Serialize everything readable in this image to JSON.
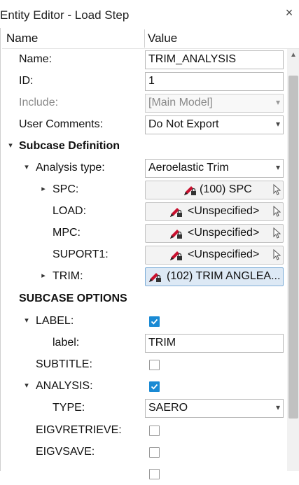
{
  "window": {
    "title": "Entity Editor - Load Step",
    "close_glyph": "×"
  },
  "columns": {
    "name": "Name",
    "value": "Value"
  },
  "fields": {
    "name": {
      "label": "Name:",
      "value": "TRIM_ANALYSIS"
    },
    "id": {
      "label": "ID:",
      "value": "1"
    },
    "include": {
      "label": "Include:",
      "value": "[Main Model]"
    },
    "user_comments": {
      "label": "User Comments:",
      "value": "Do Not Export"
    }
  },
  "subcase_definition": {
    "header": "Subcase Definition",
    "analysis_type": {
      "label": "Analysis type:",
      "value": "Aeroelastic Trim"
    },
    "spc": {
      "label": "SPC:",
      "value": "(100) SPC"
    },
    "load": {
      "label": "LOAD:",
      "value": "<Unspecified>"
    },
    "mpc": {
      "label": "MPC:",
      "value": "<Unspecified>"
    },
    "suport1": {
      "label": "SUPORT1:",
      "value": "<Unspecified>"
    },
    "trim": {
      "label": "TRIM:",
      "value": "(102) TRIM ANGLEA..."
    }
  },
  "subcase_options": {
    "header": "SUBCASE OPTIONS",
    "label_opt": {
      "label": "LABEL:",
      "checked": true
    },
    "label_value": {
      "label": "label:",
      "value": "TRIM"
    },
    "subtitle": {
      "label": "SUBTITLE:",
      "checked": false
    },
    "analysis": {
      "label": "ANALYSIS:",
      "checked": true
    },
    "type": {
      "label": "TYPE:",
      "value": "SAERO"
    },
    "eigvretrieve": {
      "label": "EIGVRETRIEVE:",
      "checked": false
    },
    "eigvsave": {
      "label": "EIGVSAVE:",
      "checked": false
    }
  },
  "icons": {
    "expand": "▾",
    "collapse": "▸",
    "dropdown": "chevron-down-icon",
    "entity": "pencil-lock-icon",
    "pointer": "pointer-icon"
  },
  "colors": {
    "checkbox_on": "#1a8ad4",
    "selected_ref": "#dde9f5",
    "entity_icon": "#c8102e"
  }
}
